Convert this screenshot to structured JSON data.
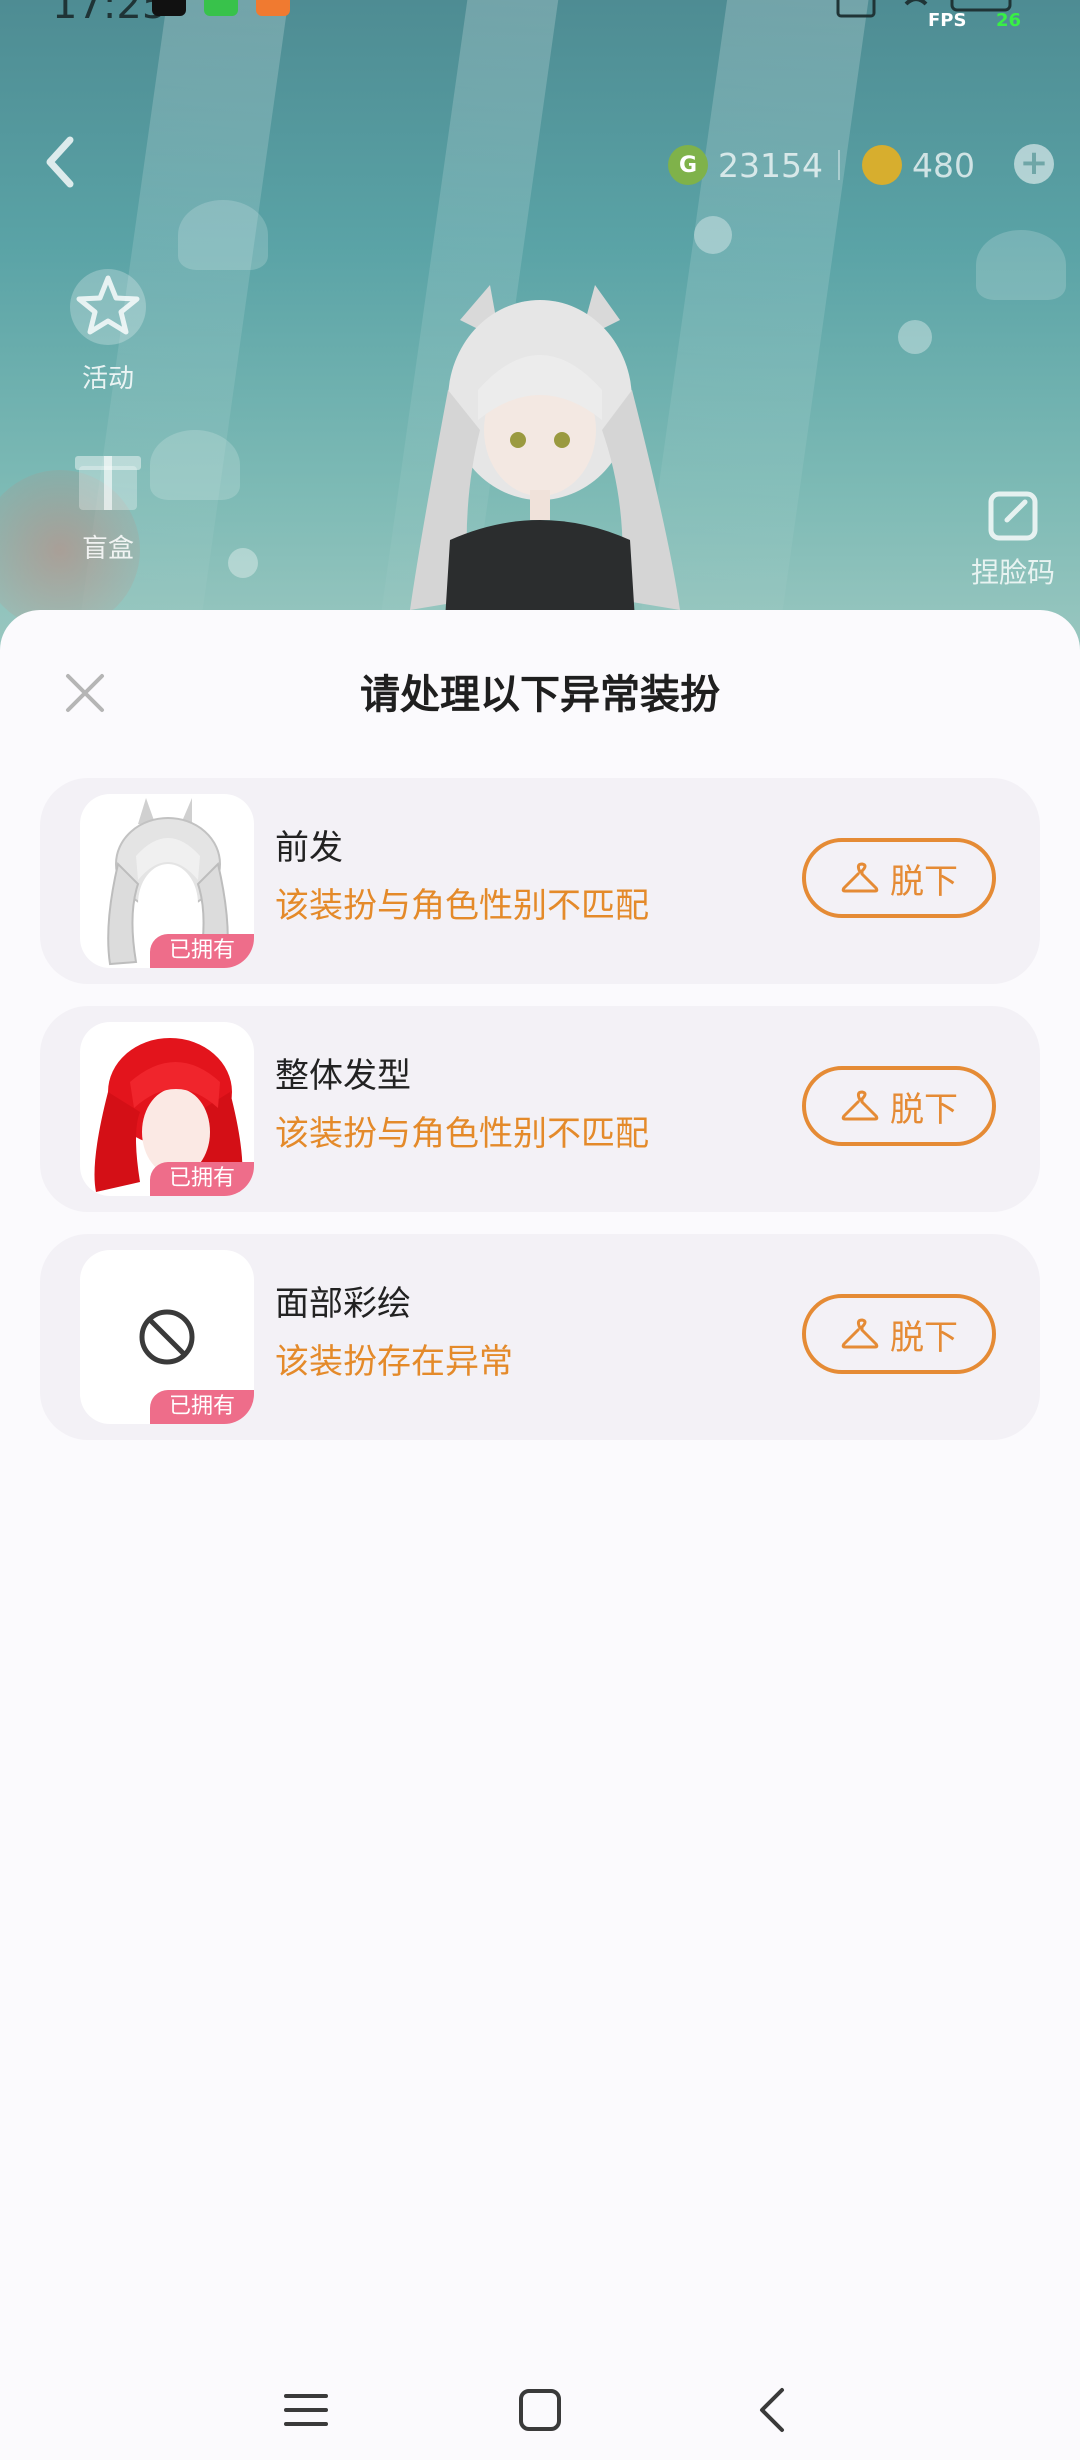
{
  "status_bar": {
    "time": "17:25",
    "fps_label": "FPS",
    "fps_value": "26"
  },
  "scene": {
    "currency_green": "23154",
    "currency_gold": "480",
    "green_coin_symbol": "G",
    "side_entries": [
      {
        "label": "活动",
        "icon": "star-badge-icon"
      },
      {
        "label": "盲盒",
        "icon": "gift-box-icon"
      }
    ],
    "face_code_label": "捏脸码"
  },
  "sheet": {
    "title": "请处理以下异常装扮",
    "items": [
      {
        "name": "前发",
        "warning": "该装扮与角色性别不匹配",
        "badge": "已拥有",
        "button": "脱下",
        "thumb": "white-hair-thumbnail"
      },
      {
        "name": "整体发型",
        "warning": "该装扮与角色性别不匹配",
        "badge": "已拥有",
        "button": "脱下",
        "thumb": "red-hair-thumbnail"
      },
      {
        "name": "面部彩绘",
        "warning": "该装扮存在异常",
        "badge": "已拥有",
        "button": "脱下",
        "thumb": "prohibited-icon"
      }
    ]
  },
  "colors": {
    "accent_orange": "#e58b35",
    "warning_text": "#e48a2a",
    "badge_pink": "#ee6d8a",
    "card_bg": "#f3f1f6"
  }
}
